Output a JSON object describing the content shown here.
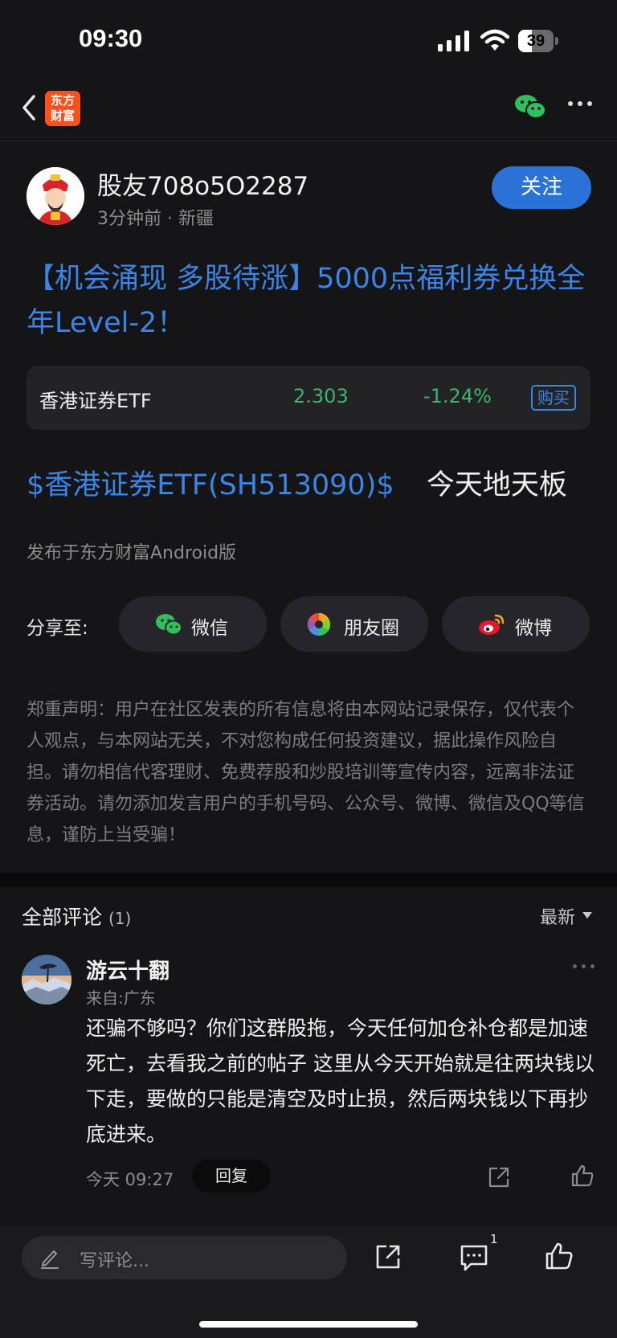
{
  "status_bar": {
    "time": "09:30",
    "battery_level": "39",
    "battery_fraction": 0.39
  },
  "nav": {
    "logo_line1": "东方",
    "logo_line2": "财富",
    "back_icon": "chevron-left-icon",
    "share_icon": "wechat-icon",
    "more_icon": "more-icon"
  },
  "author": {
    "name": "股友708o5O2287",
    "meta": "3分钟前 · 新疆",
    "follow_label": "关注"
  },
  "post": {
    "title": "【机会涌现 多股待涨】5000点福利券兑换全年Level-2！",
    "stock": {
      "name": "香港证券ETF",
      "price": "2.303",
      "change": "-1.24%",
      "buy_label": "购买",
      "color": "#3bb56b"
    },
    "body_tag": "$香港证券ETF(SH513090)$",
    "body_text": "今天地天板",
    "source": "发布于东方财富Android版"
  },
  "share": {
    "label": "分享至:",
    "wechat": "微信",
    "moments": "朋友圈",
    "weibo": "微博"
  },
  "disclaimer": "郑重声明：用户在社区发表的所有信息将由本网站记录保存，仅代表个人观点，与本网站无关，不对您构成任何投资建议，据此操作风险自担。请勿相信代客理财、免费荐股和炒股培训等宣传内容，远离非法证券活动。请勿添加发言用户的手机号码、公众号、微博、微信及QQ等信息，谨防上当受骗！",
  "comments": {
    "header": "全部评论",
    "count": "(1)",
    "sort_label": "最新",
    "items": [
      {
        "name": "游云十翻",
        "location": "来自:广东",
        "text": "还骗不够吗？你们这群股拖，今天任何加仓补仓都是加速死亡，去看我之前的帖子 这里从今天开始就是往两块钱以下走，要做的只能是清空及时止损，然后两块钱以下再抄底进来。",
        "time": "今天 09:27",
        "reply_label": "回复"
      }
    ]
  },
  "bottom_bar": {
    "placeholder": "写评论...",
    "comment_badge": "1"
  },
  "colors": {
    "accent": "#2a72d6",
    "link": "#3a85e6",
    "down": "#3bb56b",
    "background": "#151517"
  }
}
